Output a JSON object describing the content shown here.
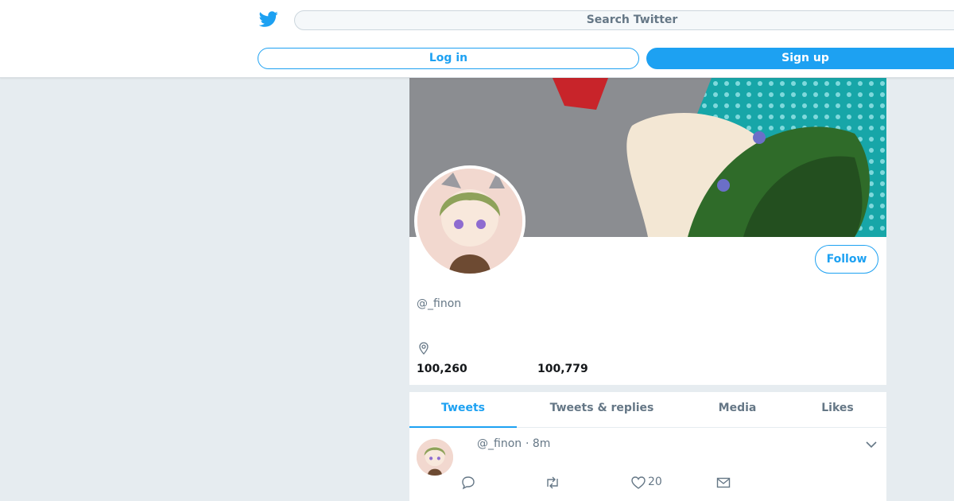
{
  "header": {
    "search_placeholder": "Search Twitter",
    "login_label": "Log in",
    "signup_label": "Sign up"
  },
  "profile": {
    "handle": "@_finon",
    "follow_label": "Follow",
    "stats": [
      "100,260",
      "100,779"
    ]
  },
  "tabs": [
    {
      "label": "Tweets",
      "active": true
    },
    {
      "label": "Tweets & replies",
      "active": false
    },
    {
      "label": "Media",
      "active": false
    },
    {
      "label": "Likes",
      "active": false
    }
  ],
  "tweet": {
    "handle": "@_finon",
    "time": "· 8m",
    "like_count": "20"
  },
  "icons": {
    "logo": "twitter-bird-icon",
    "location": "location-pin-icon",
    "reply": "reply-icon",
    "retweet": "retweet-icon",
    "like": "heart-icon",
    "dm": "mail-icon",
    "more": "chevron-down-icon"
  },
  "colors": {
    "brand": "#1da1f2",
    "muted": "#657786",
    "background": "#e6ecf0"
  }
}
